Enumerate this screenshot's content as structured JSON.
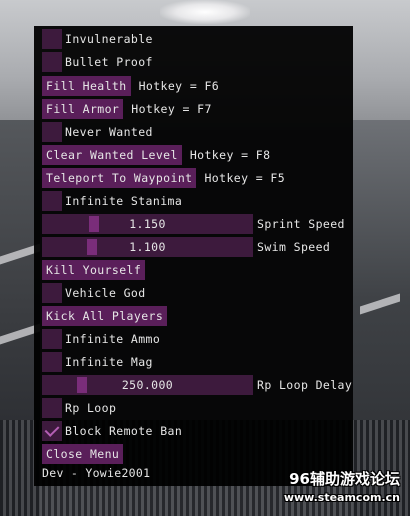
{
  "colors": {
    "window_bg": "#000000",
    "checkbox_bg": "#3d1a3d",
    "button_bg": "#5a1f5a",
    "slider_grab": "#7a2d7a",
    "checkmark": "#b45fb4",
    "text": "#e6e6e6"
  },
  "menu": {
    "invulnerable": {
      "label": "Invulnerable",
      "checked": false
    },
    "bullet_proof": {
      "label": "Bullet Proof",
      "checked": false
    },
    "fill_health": {
      "label": "Fill Health",
      "hotkey": "Hotkey = F6"
    },
    "fill_armor": {
      "label": "Fill Armor",
      "hotkey": "Hotkey = F7"
    },
    "never_wanted": {
      "label": "Never Wanted",
      "checked": false
    },
    "clear_wanted": {
      "label": "Clear Wanted Level",
      "hotkey": "Hotkey = F8"
    },
    "teleport": {
      "label": "Teleport To Waypoint",
      "hotkey": "Hotkey = F5"
    },
    "infinite_stamina": {
      "label": "Infinite Stanima",
      "checked": false
    },
    "sprint_speed": {
      "label": "Sprint Speed",
      "value": "1.150"
    },
    "swim_speed": {
      "label": "Swim Speed",
      "value": "1.100"
    },
    "kill_yourself": {
      "label": "Kill Yourself"
    },
    "vehicle_god": {
      "label": "Vehicle God",
      "checked": false
    },
    "kick_all": {
      "label": "Kick All Players"
    },
    "infinite_ammo": {
      "label": "Infinite Ammo",
      "checked": false
    },
    "infinite_mag": {
      "label": "Infinite Mag",
      "checked": false
    },
    "rp_loop_delay": {
      "label": "Rp Loop Delay",
      "value": "250.000"
    },
    "rp_loop": {
      "label": "Rp Loop",
      "checked": false
    },
    "block_remote_ban": {
      "label": "Block Remote Ban",
      "checked": true
    },
    "close_menu": {
      "label": "Close Menu"
    },
    "footer": "Dev - Yowie2001"
  },
  "watermark": {
    "line1": "96辅助游戏论坛",
    "line2": "www.steamcom.cn"
  }
}
